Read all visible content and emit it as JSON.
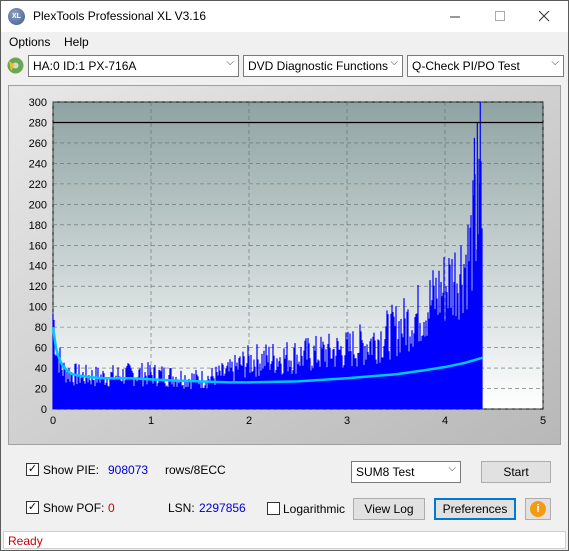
{
  "window": {
    "title": "PlexTools Professional XL V3.16",
    "app_icon_text": "XL"
  },
  "menu": {
    "options": "Options",
    "help": "Help"
  },
  "toolbar": {
    "drive": "HA:0 ID:1  PX-716A",
    "function": "DVD Diagnostic Functions",
    "test": "Q-Check PI/PO Test"
  },
  "chart_data": {
    "type": "bar",
    "x_ticks": [
      "0",
      "1",
      "2",
      "3",
      "4",
      "5"
    ],
    "y_ticks": [
      "0",
      "20",
      "40",
      "60",
      "80",
      "100",
      "120",
      "140",
      "160",
      "180",
      "200",
      "220",
      "240",
      "260",
      "280",
      "300"
    ],
    "xlim": [
      0,
      5
    ],
    "ylim": [
      0,
      300
    ],
    "threshold": 280,
    "data_end_x": 4.38,
    "series": [
      {
        "color": "#0000ff",
        "x": [
          0.0,
          0.03,
          0.06,
          0.1,
          0.2,
          0.3,
          0.5,
          0.8,
          1.0,
          1.2,
          1.4,
          1.5,
          1.6,
          1.8,
          1.9,
          2.0,
          2.2,
          2.4,
          2.6,
          2.8,
          3.0,
          3.2,
          3.4,
          3.6,
          3.8,
          3.9,
          4.0,
          4.1,
          4.2,
          4.25,
          4.3,
          4.33,
          4.36,
          4.38
        ],
        "values": [
          110,
          75,
          60,
          45,
          40,
          38,
          37,
          40,
          40,
          38,
          35,
          34,
          36,
          42,
          50,
          55,
          58,
          60,
          62,
          65,
          68,
          75,
          85,
          98,
          115,
          128,
          140,
          152,
          168,
          180,
          205,
          215,
          230,
          220
        ]
      },
      {
        "color": "#00c8ff",
        "x": [
          0.0,
          0.03,
          0.06,
          0.1,
          0.15,
          0.2,
          0.3,
          0.5,
          0.8,
          1.0,
          1.2,
          1.5,
          1.8,
          2.0,
          2.5,
          3.0,
          3.5,
          3.8,
          4.0,
          4.2,
          4.38
        ],
        "values": [
          80,
          60,
          50,
          42,
          37,
          34,
          32,
          30,
          30,
          29,
          28,
          27,
          26,
          26,
          27,
          30,
          34,
          38,
          41,
          45,
          50
        ]
      }
    ]
  },
  "bottom": {
    "show_pie_label": "Show PIE:",
    "pie_value": "908073",
    "rows_label": "rows/8ECC",
    "show_pof_label": "Show POF:",
    "pof_value": "0",
    "lsn_label": "LSN:",
    "lsn_value": "2297856",
    "logarithmic_label": "Logarithmic",
    "sum8_option": "SUM8 Test",
    "start_label": "Start",
    "viewlog_label": "View Log",
    "preferences_label": "Preferences",
    "info_icon_text": "i"
  },
  "status": {
    "text": "Ready"
  }
}
